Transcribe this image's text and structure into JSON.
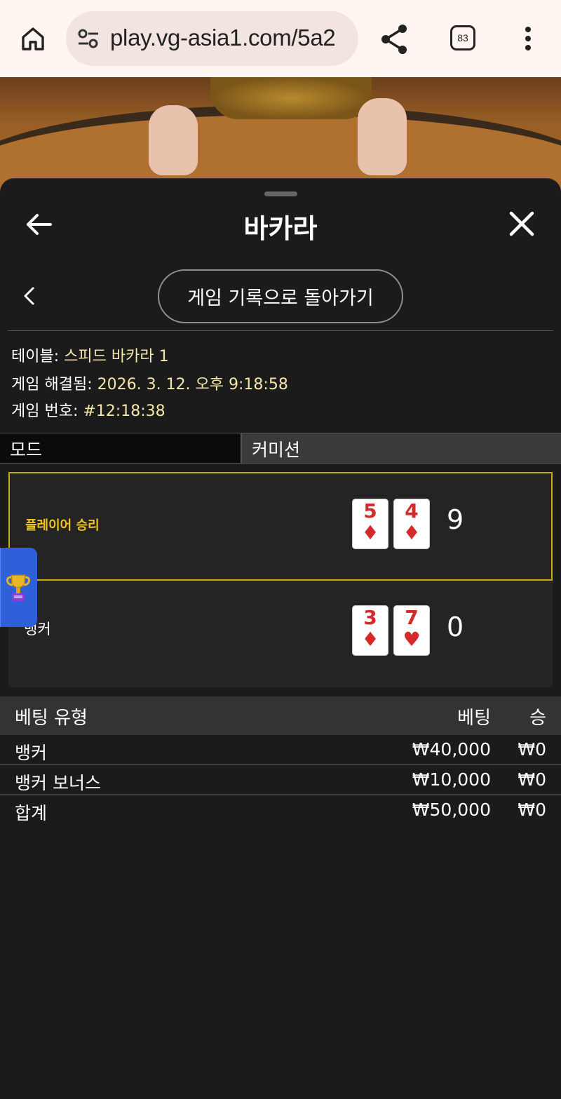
{
  "browser": {
    "url": "play.vg-asia1.com/5a2",
    "tab_count": "83"
  },
  "sheet": {
    "title": "바카라",
    "back_to_records_label": "게임 기록으로 돌아가기"
  },
  "info": {
    "table_label": "테이블:",
    "table_value": "스피드 바카라 1",
    "resolved_label": "게임 해결됨:",
    "resolved_value": "2026. 3. 12. 오후 9:18:58",
    "game_no_label": "게임 번호:",
    "game_no_value": "#12:18:38"
  },
  "mode": {
    "label": "모드",
    "value": "커미션"
  },
  "result": {
    "player": {
      "label": "플레이어 승리",
      "cards": [
        {
          "rank": "5",
          "suit": "♦"
        },
        {
          "rank": "4",
          "suit": "♦"
        }
      ],
      "score": "9"
    },
    "banker": {
      "label": "뱅커",
      "cards": [
        {
          "rank": "3",
          "suit": "♦"
        },
        {
          "rank": "7",
          "suit": "♥"
        }
      ],
      "score": "0"
    }
  },
  "bets": {
    "headers": {
      "type": "베팅 유형",
      "bet": "베팅",
      "win": "승"
    },
    "rows": [
      {
        "type": "뱅커",
        "bet": "₩40,000",
        "win": "₩0"
      },
      {
        "type": "뱅커 보너스",
        "bet": "₩10,000",
        "win": "₩0"
      }
    ],
    "total": {
      "type": "합계",
      "bet": "₩50,000",
      "win": "₩0"
    }
  },
  "colors": {
    "accent_gold": "#f2c41c",
    "card_red": "#d42a2a",
    "panel_bg": "#1b1b1b",
    "trophy_tab": "#2f5fd9"
  }
}
